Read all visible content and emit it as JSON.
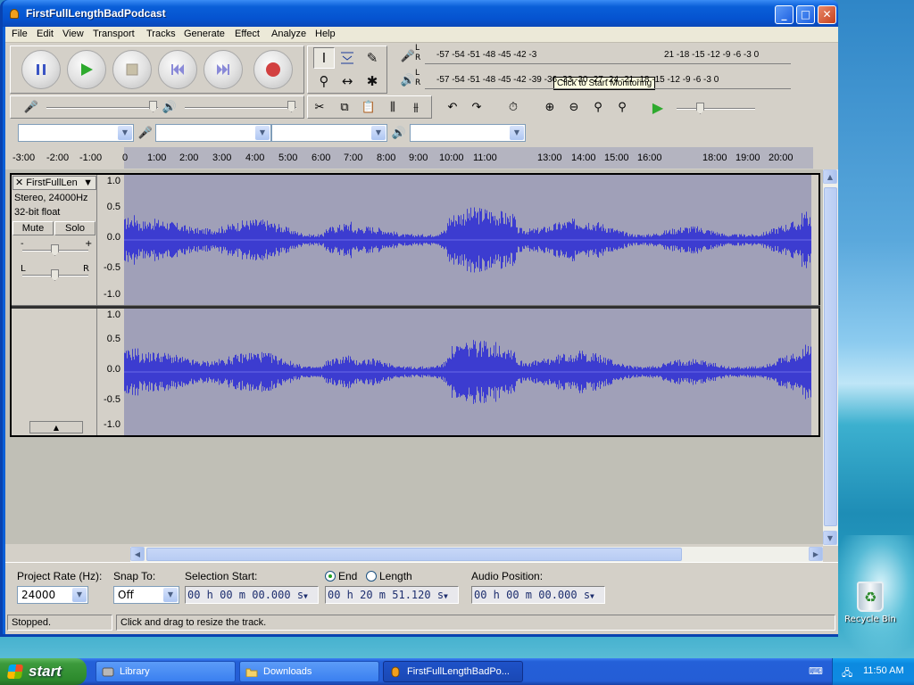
{
  "window": {
    "title": "FirstFullLengthBadPodcast",
    "min": "_",
    "max": "□",
    "close": "✕"
  },
  "menu": [
    "File",
    "Edit",
    "View",
    "Transport",
    "Tracks",
    "Generate",
    "Effect",
    "Analyze",
    "Help"
  ],
  "meters": {
    "scale_top": "-57 -54 -51 -48 -45 -42 -3",
    "scale_top_right": "21 -18 -15 -12 -9 -6 -3 0",
    "scale_bottom": "-57 -54 -51 -48 -45 -42 -39 -36 -33 -30 -27 -24 -21 -18 -15 -12 -9 -6 -3 0",
    "tooltip": "Click to Start Monitoring",
    "lr_l": "L",
    "lr_r": "R"
  },
  "ruler": {
    "labels": [
      "-3:00",
      "-2:00",
      "-1:00",
      "0",
      "1:00",
      "2:00",
      "3:00",
      "4:00",
      "5:00",
      "6:00",
      "7:00",
      "8:00",
      "9:00",
      "10:00",
      "11:00",
      "13:00",
      "14:00",
      "15:00",
      "16:00",
      "18:00",
      "19:00",
      "20:00"
    ]
  },
  "track": {
    "name": "FirstFullLen",
    "format": "Stereo, 24000Hz",
    "depth": "32-bit float",
    "mute": "Mute",
    "solo": "Solo",
    "gain_l": "-",
    "gain_r": "+",
    "pan_l": "L",
    "pan_r": "R",
    "scale": [
      "1.0",
      "0.5",
      "0.0",
      "-0.5",
      "-1.0"
    ]
  },
  "selection": {
    "rate_label": "Project Rate (Hz):",
    "rate_value": "24000",
    "snap_label": "Snap To:",
    "snap_value": "Off",
    "start_label": "Selection Start:",
    "start_value": "00 h 00 m 00.000 s",
    "end_label": "End",
    "length_label": "Length",
    "end_value": "00 h 20 m 51.120 s",
    "audio_pos_label": "Audio Position:",
    "audio_pos_value": "00 h 00 m 00.000 s"
  },
  "status": {
    "left": "Stopped.",
    "right": "Click and drag to resize the track."
  },
  "desktop": {
    "recycle": "Recycle Bin"
  },
  "taskbar": {
    "start": "start",
    "tasks": [
      "Library",
      "Downloads",
      "FirstFullLengthBadPo..."
    ],
    "clock": "11:50 AM"
  },
  "colors": {
    "waveform": "#3c3cd0",
    "waveform_bg": "#a0a0b8",
    "title_blue": "#0a5fd8",
    "start_green": "#3c9a3c"
  }
}
